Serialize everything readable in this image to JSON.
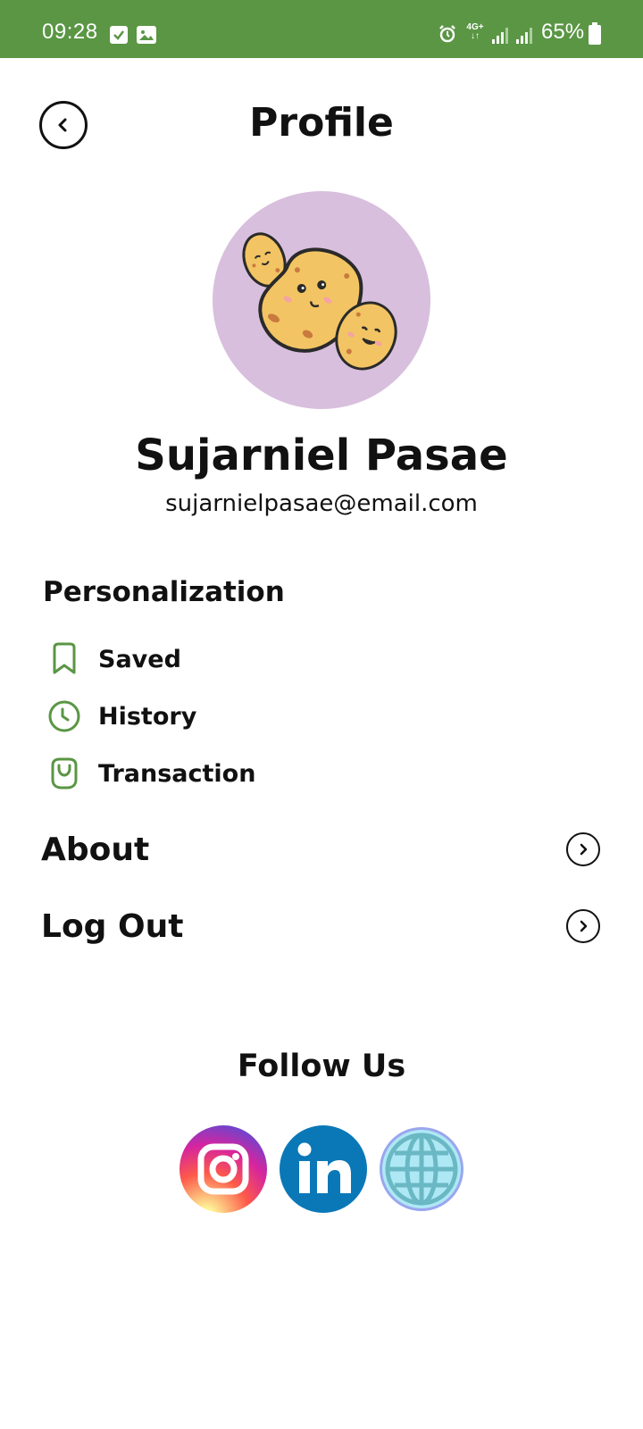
{
  "status_bar": {
    "time": "09:28",
    "network": "4G+",
    "battery": "65%",
    "background_color": "#5a9644"
  },
  "header": {
    "title": "Profile",
    "back_icon": "chevron-left-icon"
  },
  "profile": {
    "avatar": "potato-avatar",
    "avatar_background": "#d8bfdd",
    "name": "Sujarniel Pasae",
    "email": "sujarnielpasae@email.com"
  },
  "personalization": {
    "heading": "Personalization",
    "accent_color": "#5a9644",
    "items": [
      {
        "label": "Saved",
        "icon": "bookmark-icon"
      },
      {
        "label": "History",
        "icon": "clock-icon"
      },
      {
        "label": "Transaction",
        "icon": "shopping-bag-icon"
      }
    ]
  },
  "navigation": [
    {
      "label": "About",
      "icon": "chevron-right-circle-icon"
    },
    {
      "label": "Log Out",
      "icon": "chevron-right-circle-icon"
    }
  ],
  "follow": {
    "title": "Follow Us",
    "links": [
      {
        "name": "instagram",
        "icon": "instagram-icon"
      },
      {
        "name": "linkedin",
        "icon": "linkedin-icon"
      },
      {
        "name": "website",
        "icon": "globe-icon"
      }
    ]
  }
}
